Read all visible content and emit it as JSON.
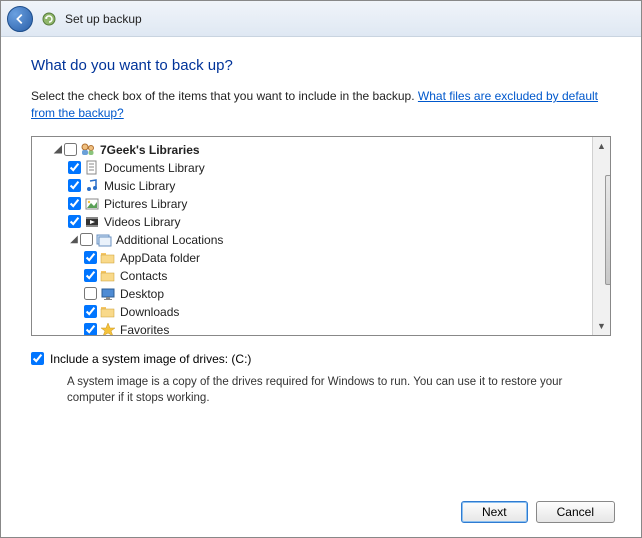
{
  "titlebar": {
    "title": "Set up backup"
  },
  "heading": "What do you want to back up?",
  "instruction_prefix": "Select the check box of the items that you want to include in the backup. ",
  "instruction_link": "What files are excluded by default from the backup?",
  "tree": {
    "root": {
      "label": "7Geek's Libraries",
      "children": [
        {
          "label": "Documents Library",
          "checked": true,
          "icon": "doc"
        },
        {
          "label": "Music Library",
          "checked": true,
          "icon": "music"
        },
        {
          "label": "Pictures Library",
          "checked": true,
          "icon": "picture"
        },
        {
          "label": "Videos Library",
          "checked": true,
          "icon": "video"
        }
      ],
      "additional": {
        "label": "Additional Locations",
        "children": [
          {
            "label": "AppData folder",
            "checked": true,
            "icon": "folder"
          },
          {
            "label": "Contacts",
            "checked": true,
            "icon": "folder"
          },
          {
            "label": "Desktop",
            "checked": false,
            "icon": "folder"
          },
          {
            "label": "Downloads",
            "checked": true,
            "icon": "folder"
          },
          {
            "label": "Favorites",
            "checked": true,
            "icon": "star"
          }
        ]
      }
    }
  },
  "system_image": {
    "checkbox_label": "Include a system image of drives: (C:)",
    "checked": true,
    "description": "A system image is a copy of the drives required for Windows to run. You can use it to restore your computer if it stops working."
  },
  "buttons": {
    "next": "Next",
    "cancel": "Cancel"
  }
}
